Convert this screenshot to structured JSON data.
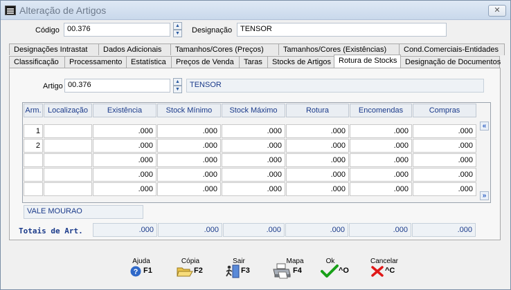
{
  "window": {
    "title": "Alteração de Artigos",
    "close": "✕"
  },
  "header": {
    "codigo_label": "Código",
    "codigo_value": "00.376",
    "designacao_label": "Designação",
    "designacao_value": "TENSOR"
  },
  "tabs_row1": [
    "Designações Intrastat",
    "Dados Adicionais",
    "Tamanhos/Cores (Preços)",
    "Tamanhos/Cores (Existências)",
    "Cond.Comerciais-Entidades"
  ],
  "tabs_row2": [
    "Classificação",
    "Processamento",
    "Estatística",
    "Preços de Venda",
    "Taras",
    "Stocks de Artigos",
    "Rotura de Stocks",
    "Designação de Documentos"
  ],
  "active_tab": "Rotura de Stocks",
  "panel": {
    "artigo_label": "Artigo",
    "artigo_value": "00.376",
    "artigo_desc": "TENSOR",
    "columns": [
      "Arm.",
      "Localização",
      "Existência",
      "Stock Mínimo",
      "Stock Máximo",
      "Rotura",
      "Encomendas",
      "Compras"
    ],
    "rows": [
      [
        "1",
        "",
        ".000",
        ".000",
        ".000",
        ".000",
        ".000",
        ".000"
      ],
      [
        "2",
        "",
        ".000",
        ".000",
        ".000",
        ".000",
        ".000",
        ".000"
      ],
      [
        "",
        "",
        ".000",
        ".000",
        ".000",
        ".000",
        ".000",
        ".000"
      ],
      [
        "",
        "",
        ".000",
        ".000",
        ".000",
        ".000",
        ".000",
        ".000"
      ],
      [
        "",
        "",
        ".000",
        ".000",
        ".000",
        ".000",
        ".000",
        ".000"
      ]
    ],
    "nav_up": "«",
    "nav_down": "»",
    "armazem_name": "VALE MOURAO",
    "totais_label": "Totais de Art.",
    "totais": [
      ".000",
      ".000",
      ".000",
      ".000",
      ".000",
      ".000"
    ]
  },
  "toolbar": {
    "ajuda": "Ajuda",
    "ajuda_key": "F1",
    "copia": "Cópia",
    "copia_key": "F2",
    "sair": "Sair",
    "sair_key": "F3",
    "mapa": "Mapa",
    "mapa_key": "F4",
    "ok": "Ok",
    "ok_key": "^O",
    "cancelar": "Cancelar",
    "cancelar_key": "^C"
  }
}
